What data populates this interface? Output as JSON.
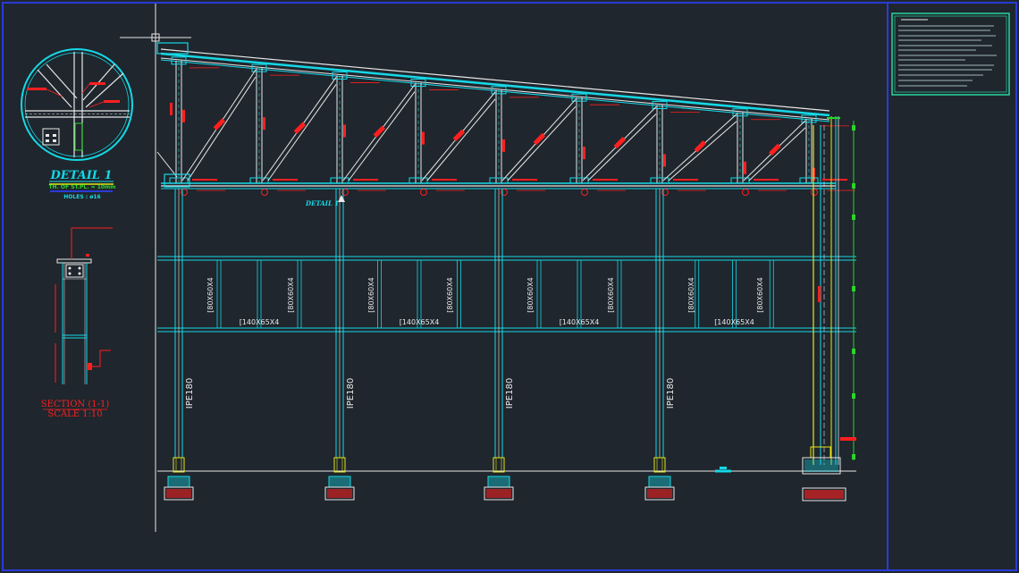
{
  "detail": {
    "title": "DETAIL 1",
    "thickness": "TH. OF ST.PL. = 10mm",
    "holes": "HOLES : ø16",
    "tag": "DETAIL 1"
  },
  "section": {
    "title": "SECTION (1-1)",
    "scale": "SCALE 1:10"
  },
  "frame": {
    "column_label": "IPE180",
    "vertical_label": "80X60X4",
    "horizontal_label": "140X65X4"
  },
  "colors": {
    "background": "#1f262d",
    "frame_border": "#2a3bd6",
    "cyan": "#15d8e6",
    "red": "#ff1f1f",
    "white": "#e8e8e8",
    "yellow": "#e6e61a",
    "green": "#29d629"
  }
}
